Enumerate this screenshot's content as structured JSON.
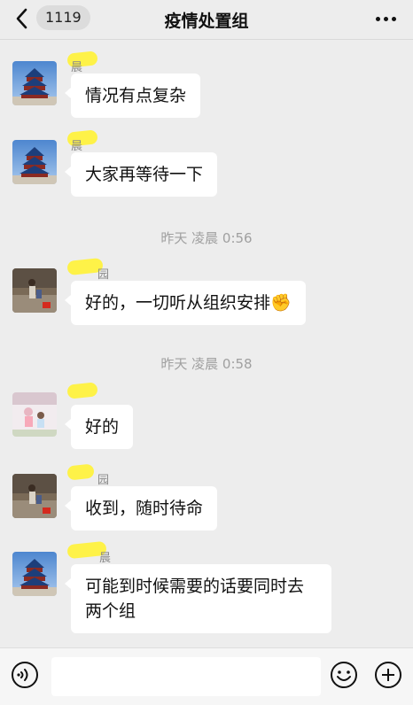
{
  "header": {
    "badge_count": "1119",
    "title": "疫情处置组"
  },
  "messages": [
    {
      "name": "晨",
      "text": "情况有点复杂"
    },
    {
      "name": "晨",
      "text": "大家再等待一下"
    },
    {
      "timestamp": "昨天 凌晨 0:56"
    },
    {
      "name": "园",
      "text": "好的，一切听从组织安排✊"
    },
    {
      "timestamp": "昨天 凌晨 0:58"
    },
    {
      "name": "",
      "text": "好的"
    },
    {
      "name": "园",
      "text": "收到，随时待命"
    },
    {
      "name": "晨",
      "text": "可能到时候需要的话要同时去两个组"
    }
  ],
  "input": {
    "placeholder": ""
  },
  "icons": [
    "back-icon",
    "more-icon",
    "voice-icon",
    "emoji-icon",
    "plus-icon"
  ],
  "colors": {
    "highlight": "#fff23a",
    "background": "#ededed",
    "bubble": "#ffffff"
  }
}
